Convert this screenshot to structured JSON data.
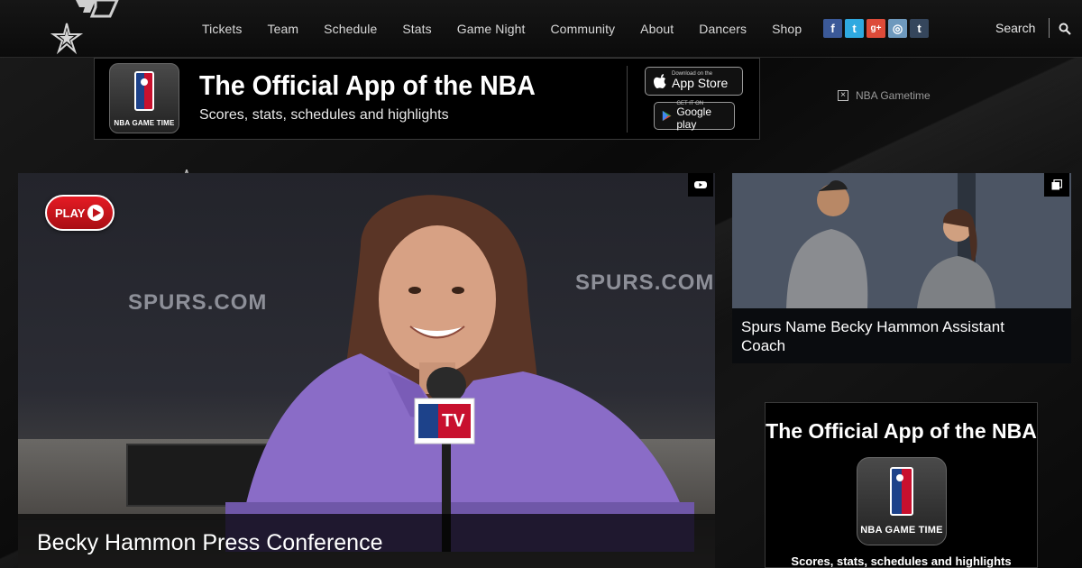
{
  "nav": {
    "items": [
      "Tickets",
      "Team",
      "Schedule",
      "Stats",
      "Game Night",
      "Community",
      "About",
      "Dancers",
      "Shop"
    ],
    "search_label": "Search",
    "social": [
      {
        "name": "facebook-icon",
        "glyph": "f",
        "color": "#3b5998"
      },
      {
        "name": "twitter-icon",
        "glyph": "t",
        "color": "#2fa9e0"
      },
      {
        "name": "googleplus-icon",
        "glyph": "g+",
        "color": "#dd4b39"
      },
      {
        "name": "instagram-icon",
        "glyph": "◎",
        "color": "#6e99bd"
      },
      {
        "name": "tumblr-icon",
        "glyph": "t",
        "color": "#35465c"
      }
    ]
  },
  "banner_ad": {
    "title": "The Official App of the NBA",
    "subtitle": "Scores, stats, schedules and highlights",
    "app_label": "NBA GAME TIME",
    "appstore_small": "Download on the",
    "appstore_big": "App Store",
    "googleplay_small": "GET IT ON",
    "googleplay_big": "Google play",
    "close_label": "NBA Gametime"
  },
  "main_video": {
    "play_label": "PLAY",
    "caption": "Becky Hammon Press Conference",
    "wall_text": "SPURS.COM",
    "mic_flag": "TV"
  },
  "side_video": {
    "caption": "Spurs Name Becky Hammon Assistant Coach"
  },
  "side_ad": {
    "title": "The Official App of the NBA",
    "app_label": "NBA GAME TIME",
    "subtitle": "Scores, stats, schedules and highlights"
  }
}
